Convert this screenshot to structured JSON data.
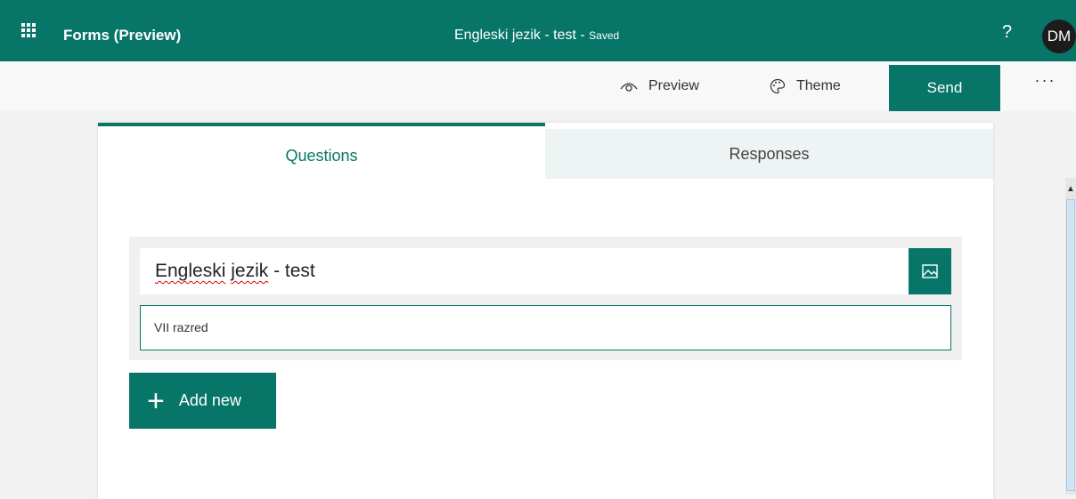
{
  "appbar": {
    "app_name": "Forms (Preview)",
    "doc_title": "Engleski jezik - test",
    "save_status": "Saved",
    "separator": " - ",
    "help": "?",
    "avatar_initials": "DM",
    "color": "#077568"
  },
  "commands": {
    "preview": "Preview",
    "theme": "Theme",
    "send": "Send",
    "more": "..."
  },
  "tabs": {
    "questions": "Questions",
    "responses": "Responses"
  },
  "form": {
    "title_word1": "Engleski",
    "title_word2": "jezik",
    "title_rest": " - test",
    "subtitle": "VII razred",
    "add_new": "Add new"
  },
  "icons": [
    "waffle-icon",
    "eye-icon",
    "palette-icon",
    "image-icon",
    "plus-icon"
  ]
}
